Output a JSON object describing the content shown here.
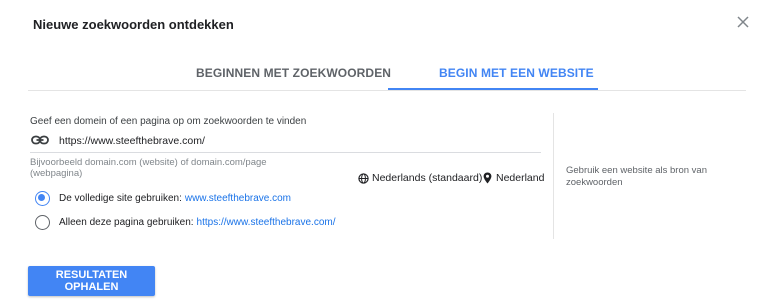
{
  "dialog": {
    "title": "Nieuwe zoekwoorden ontdekken",
    "close_icon": "close-icon"
  },
  "tabs": [
    {
      "label": "BEGINNEN MET ZOEKWOORDEN",
      "active": false
    },
    {
      "label": "BEGIN MET EEN WEBSITE",
      "active": true
    }
  ],
  "form": {
    "prompt": "Geef een domein of een pagina op om zoekwoorden te vinden",
    "url_value": "https://www.steefthebrave.com/",
    "url_icon": "link-icon",
    "helper": "Bijvoorbeeld domain.com (website) of domain.com/page (webpagina)",
    "language": "Nederlands (standaard)",
    "language_icon": "globe-icon",
    "location": "Nederland",
    "location_icon": "location-pin-icon",
    "options": [
      {
        "label": "De volledige site gebruiken:",
        "link": "www.steefthebrave.com",
        "selected": true
      },
      {
        "label": "Alleen deze pagina gebruiken:",
        "link": "https://www.steefthebrave.com/",
        "selected": false
      }
    ]
  },
  "side": {
    "text": "Gebruik een website als bron van zoekwoorden"
  },
  "actions": {
    "submit_label": "RESULTATEN OPHALEN"
  },
  "colors": {
    "accent": "#4285f4",
    "link": "#1a73e8"
  }
}
